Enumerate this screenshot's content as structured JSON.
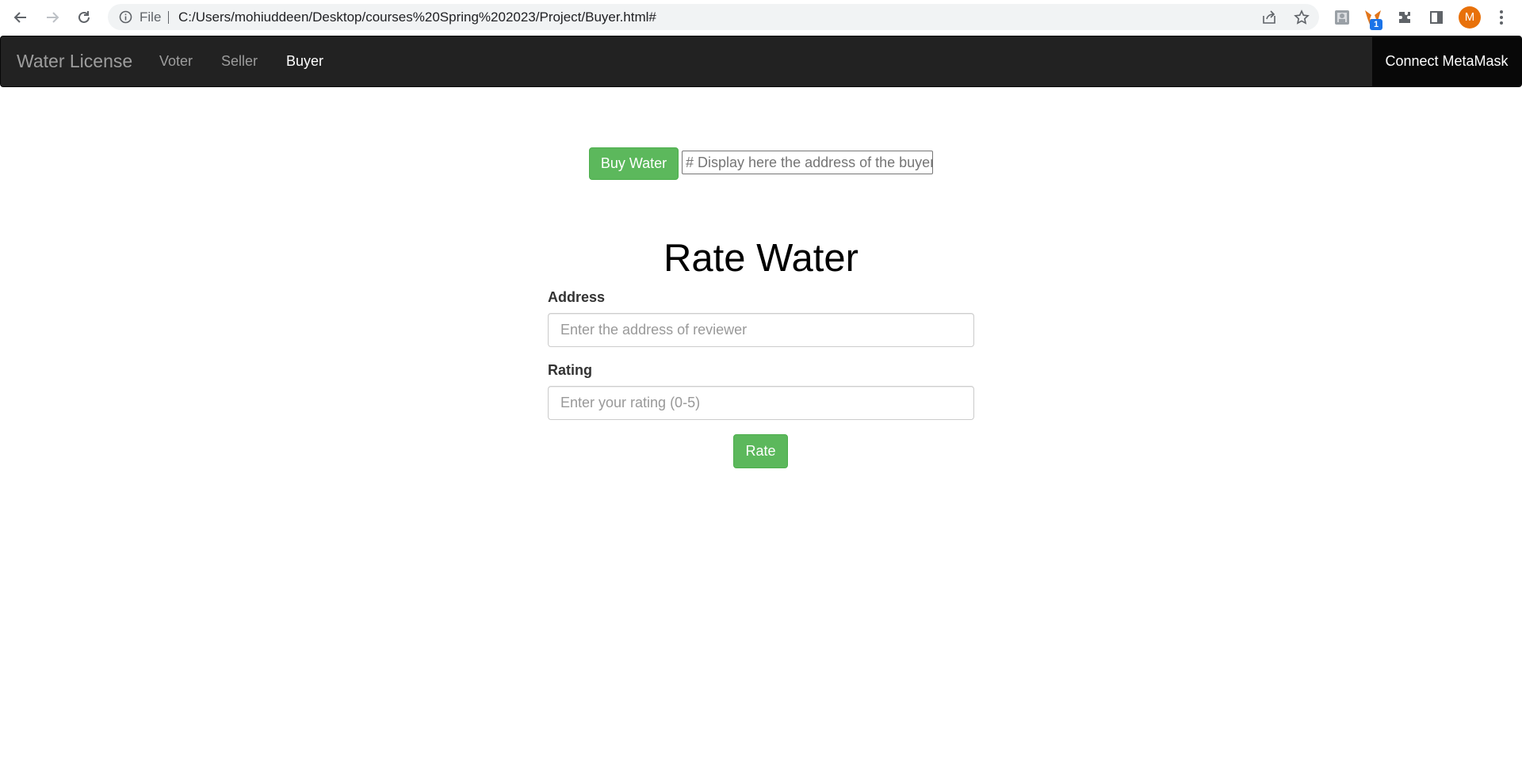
{
  "browser": {
    "file_label": "File",
    "url": "C:/Users/mohiuddeen/Desktop/courses%20Spring%202023/Project/Buyer.html#",
    "extension_badge": "1",
    "profile_initial": "M"
  },
  "navbar": {
    "brand": "Water License",
    "links": [
      "Voter",
      "Seller",
      "Buyer"
    ],
    "active_link": "Buyer",
    "connect_label": "Connect MetaMask"
  },
  "buy": {
    "button_label": "Buy Water",
    "buyer_address_placeholder": "# Display here the address of the buyer"
  },
  "rate": {
    "title": "Rate Water",
    "address_label": "Address",
    "address_placeholder": "Enter the address of reviewer",
    "rating_label": "Rating",
    "rating_placeholder": "Enter your rating (0-5)",
    "button_label": "Rate"
  },
  "colors": {
    "navbar_bg": "#222222",
    "success_green": "#5cb85c",
    "profile_orange": "#e8710a"
  }
}
